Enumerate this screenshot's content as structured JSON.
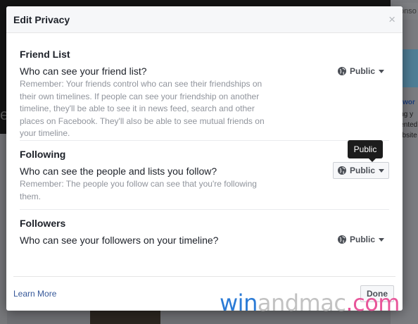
{
  "background": {
    "tab_label": "onso",
    "side_link": "owor",
    "side_lines": [
      "ing y",
      "iented",
      "ebsite"
    ]
  },
  "dialog": {
    "title": "Edit Privacy",
    "close_glyph": "×",
    "sections": [
      {
        "heading": "Friend List",
        "question": "Who can see your friend list?",
        "note": "Remember: Your friends control who can see their friendships on their own timelines. If people can see your friendship on another timeline, they'll be able to see it in news feed, search and other places on Facebook. They'll also be able to see mutual friends on your timeline.",
        "privacy": "Public"
      },
      {
        "heading": "Following",
        "question": "Who can see the people and lists you follow?",
        "note": "Remember: The people you follow can see that you're following them.",
        "privacy": "Public"
      },
      {
        "heading": "Followers",
        "question": "Who can see your followers on your timeline?",
        "note": "",
        "privacy": "Public"
      }
    ],
    "tooltip": "Public",
    "footer": {
      "learn_more": "Learn More",
      "done": "Done"
    }
  },
  "watermark": {
    "part1": "win",
    "part2": "andmac",
    "part3": ".com"
  },
  "colors": {
    "link": "#365899",
    "muted_text": "#90949c",
    "tooltip_bg": "#1c1c1c",
    "watermark_blue": "#2b7bd6",
    "watermark_pink": "#e8569a"
  },
  "icons": [
    "globe-icon",
    "caret-down-icon",
    "close-icon"
  ]
}
